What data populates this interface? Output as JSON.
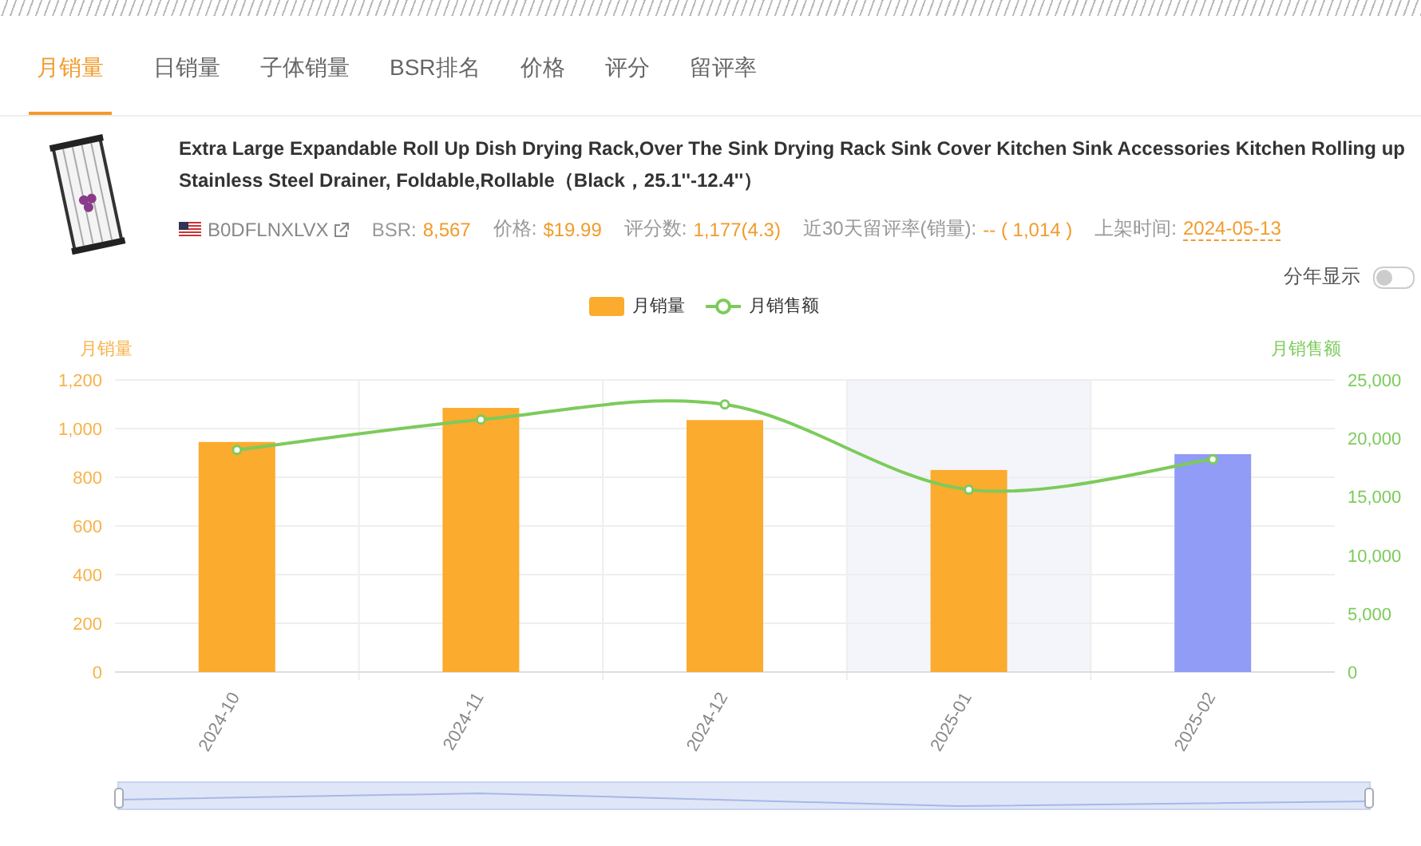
{
  "tabs": [
    {
      "label": "月销量",
      "selected": true
    },
    {
      "label": "日销量",
      "selected": false
    },
    {
      "label": "子体销量",
      "selected": false
    },
    {
      "label": "BSR排名",
      "selected": false
    },
    {
      "label": "价格",
      "selected": false
    },
    {
      "label": "评分",
      "selected": false
    },
    {
      "label": "留评率",
      "selected": false
    }
  ],
  "product": {
    "title": "Extra Large Expandable Roll Up Dish Drying Rack,Over The Sink Drying Rack Sink Cover Kitchen Sink Accessories Kitchen Rolling up Stainless Steel Drainer, Foldable,Rollable（Black，25.1''-12.4''）",
    "asin": "B0DFLNXLVX",
    "stats": [
      {
        "label": "BSR:",
        "value": "8,567",
        "kind": "plain"
      },
      {
        "label": "价格:",
        "value": "$19.99",
        "kind": "plain"
      },
      {
        "label": "评分数:",
        "value": "1,177(4.3)",
        "kind": "plain"
      },
      {
        "label": "近30天留评率(销量):",
        "value": "-- ( 1,014 )",
        "kind": "plain"
      },
      {
        "label": "上架时间:",
        "value": "2024-05-13",
        "kind": "date"
      }
    ]
  },
  "year_toggle": {
    "label": "分年显示",
    "on": false
  },
  "chart": {
    "chart_data": {
      "type": "bar",
      "grid": true,
      "bands": [
        {
          "axis": "x",
          "from": "2025-01",
          "to": "2025-01",
          "color": "#f3f5fa"
        }
      ],
      "ylabel": "月销量",
      "y2label": "月销售额",
      "categories": [
        "2024-10",
        "2024-11",
        "2024-12",
        "2025-01",
        "2025-02"
      ],
      "series": [
        {
          "name": "月销量",
          "color": "#fbab2d",
          "colors": [
            "#fbab2d",
            "#fbab2d",
            "#fbab2d",
            "#fbab2d",
            "#909cf6"
          ],
          "values": [
            945,
            1085,
            1035,
            830,
            895
          ]
        },
        {
          "name": "月销售额",
          "color": "#7ccb5b",
          "type": "line",
          "axis": "y2",
          "marker": "o",
          "values": [
            19000,
            21600,
            22900,
            15600,
            18200
          ]
        }
      ],
      "ylim": [
        0,
        1200
      ],
      "yticks": [
        0,
        200,
        400,
        600,
        800,
        {
          "value": 1000,
          "label": "1,000"
        },
        {
          "value": 1200,
          "label": "1,200"
        }
      ],
      "y2lim": [
        0,
        25000
      ],
      "y2ticks": [
        0,
        {
          "value": 5000,
          "label": "5,000"
        },
        {
          "value": 10000,
          "label": "10,000"
        },
        {
          "value": 15000,
          "label": "15,000"
        },
        {
          "value": 20000,
          "label": "20,000"
        },
        {
          "value": 25000,
          "label": "25,000"
        }
      ]
    }
  }
}
